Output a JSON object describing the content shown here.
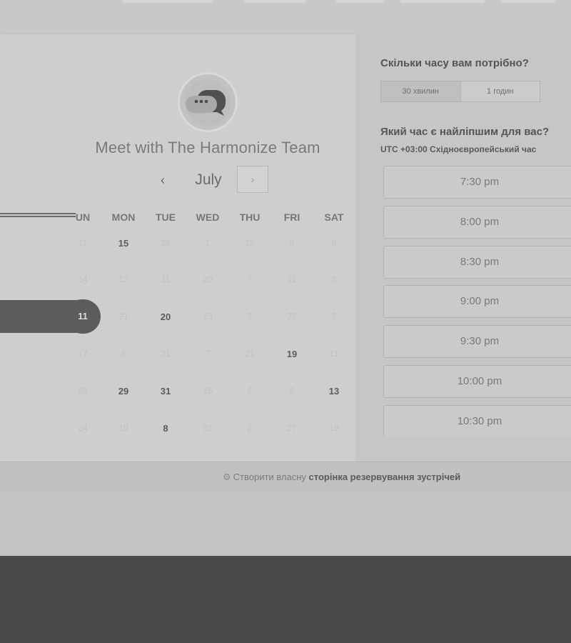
{
  "meeting": {
    "title": "Meet with The Harmonize Team",
    "avatar_icon": "chat-bubble-icon"
  },
  "calendar": {
    "month": "July",
    "prev_icon": "‹",
    "next_icon": "›",
    "weekdays": [
      "UN",
      "MON",
      "TUE",
      "WED",
      "THU",
      "FRI",
      "SAT"
    ],
    "selected_day": "11",
    "weeks": [
      [
        "11",
        "15",
        "29",
        "1",
        "15",
        "6",
        "6"
      ],
      [
        "14",
        "12",
        "11",
        "20",
        "7",
        "11",
        "3"
      ],
      [
        "11",
        "21",
        "20",
        "13",
        "3",
        "27",
        "2"
      ],
      [
        "17",
        "6",
        "31",
        "7",
        "21",
        "19",
        "11"
      ],
      [
        "28",
        "29",
        "31",
        "15",
        "6",
        "6",
        "13"
      ],
      [
        "24",
        "10",
        "8",
        "31",
        "2",
        "27",
        "19"
      ]
    ],
    "available_days": [
      "0-1",
      "2-0",
      "2-2",
      "3-5",
      "4-1",
      "4-2",
      "4-6",
      "5-2"
    ]
  },
  "duration": {
    "question": "Скільки часу вам потрібно?",
    "options": [
      "30 хвилин",
      "1 годин"
    ],
    "selected": "30 хвилин"
  },
  "time": {
    "question": "Який час є найліпшим для вас?",
    "timezone_offset": "UTC +03:00",
    "timezone_name": "Східноєвропейський час",
    "slots": [
      "7:30 pm",
      "8:00 pm",
      "8:30 pm",
      "9:00 pm",
      "9:30 pm",
      "10:00 pm",
      "10:30 pm"
    ]
  },
  "footer": {
    "prefix": "Створити власну",
    "link": "сторінка резервування зустрічей"
  }
}
